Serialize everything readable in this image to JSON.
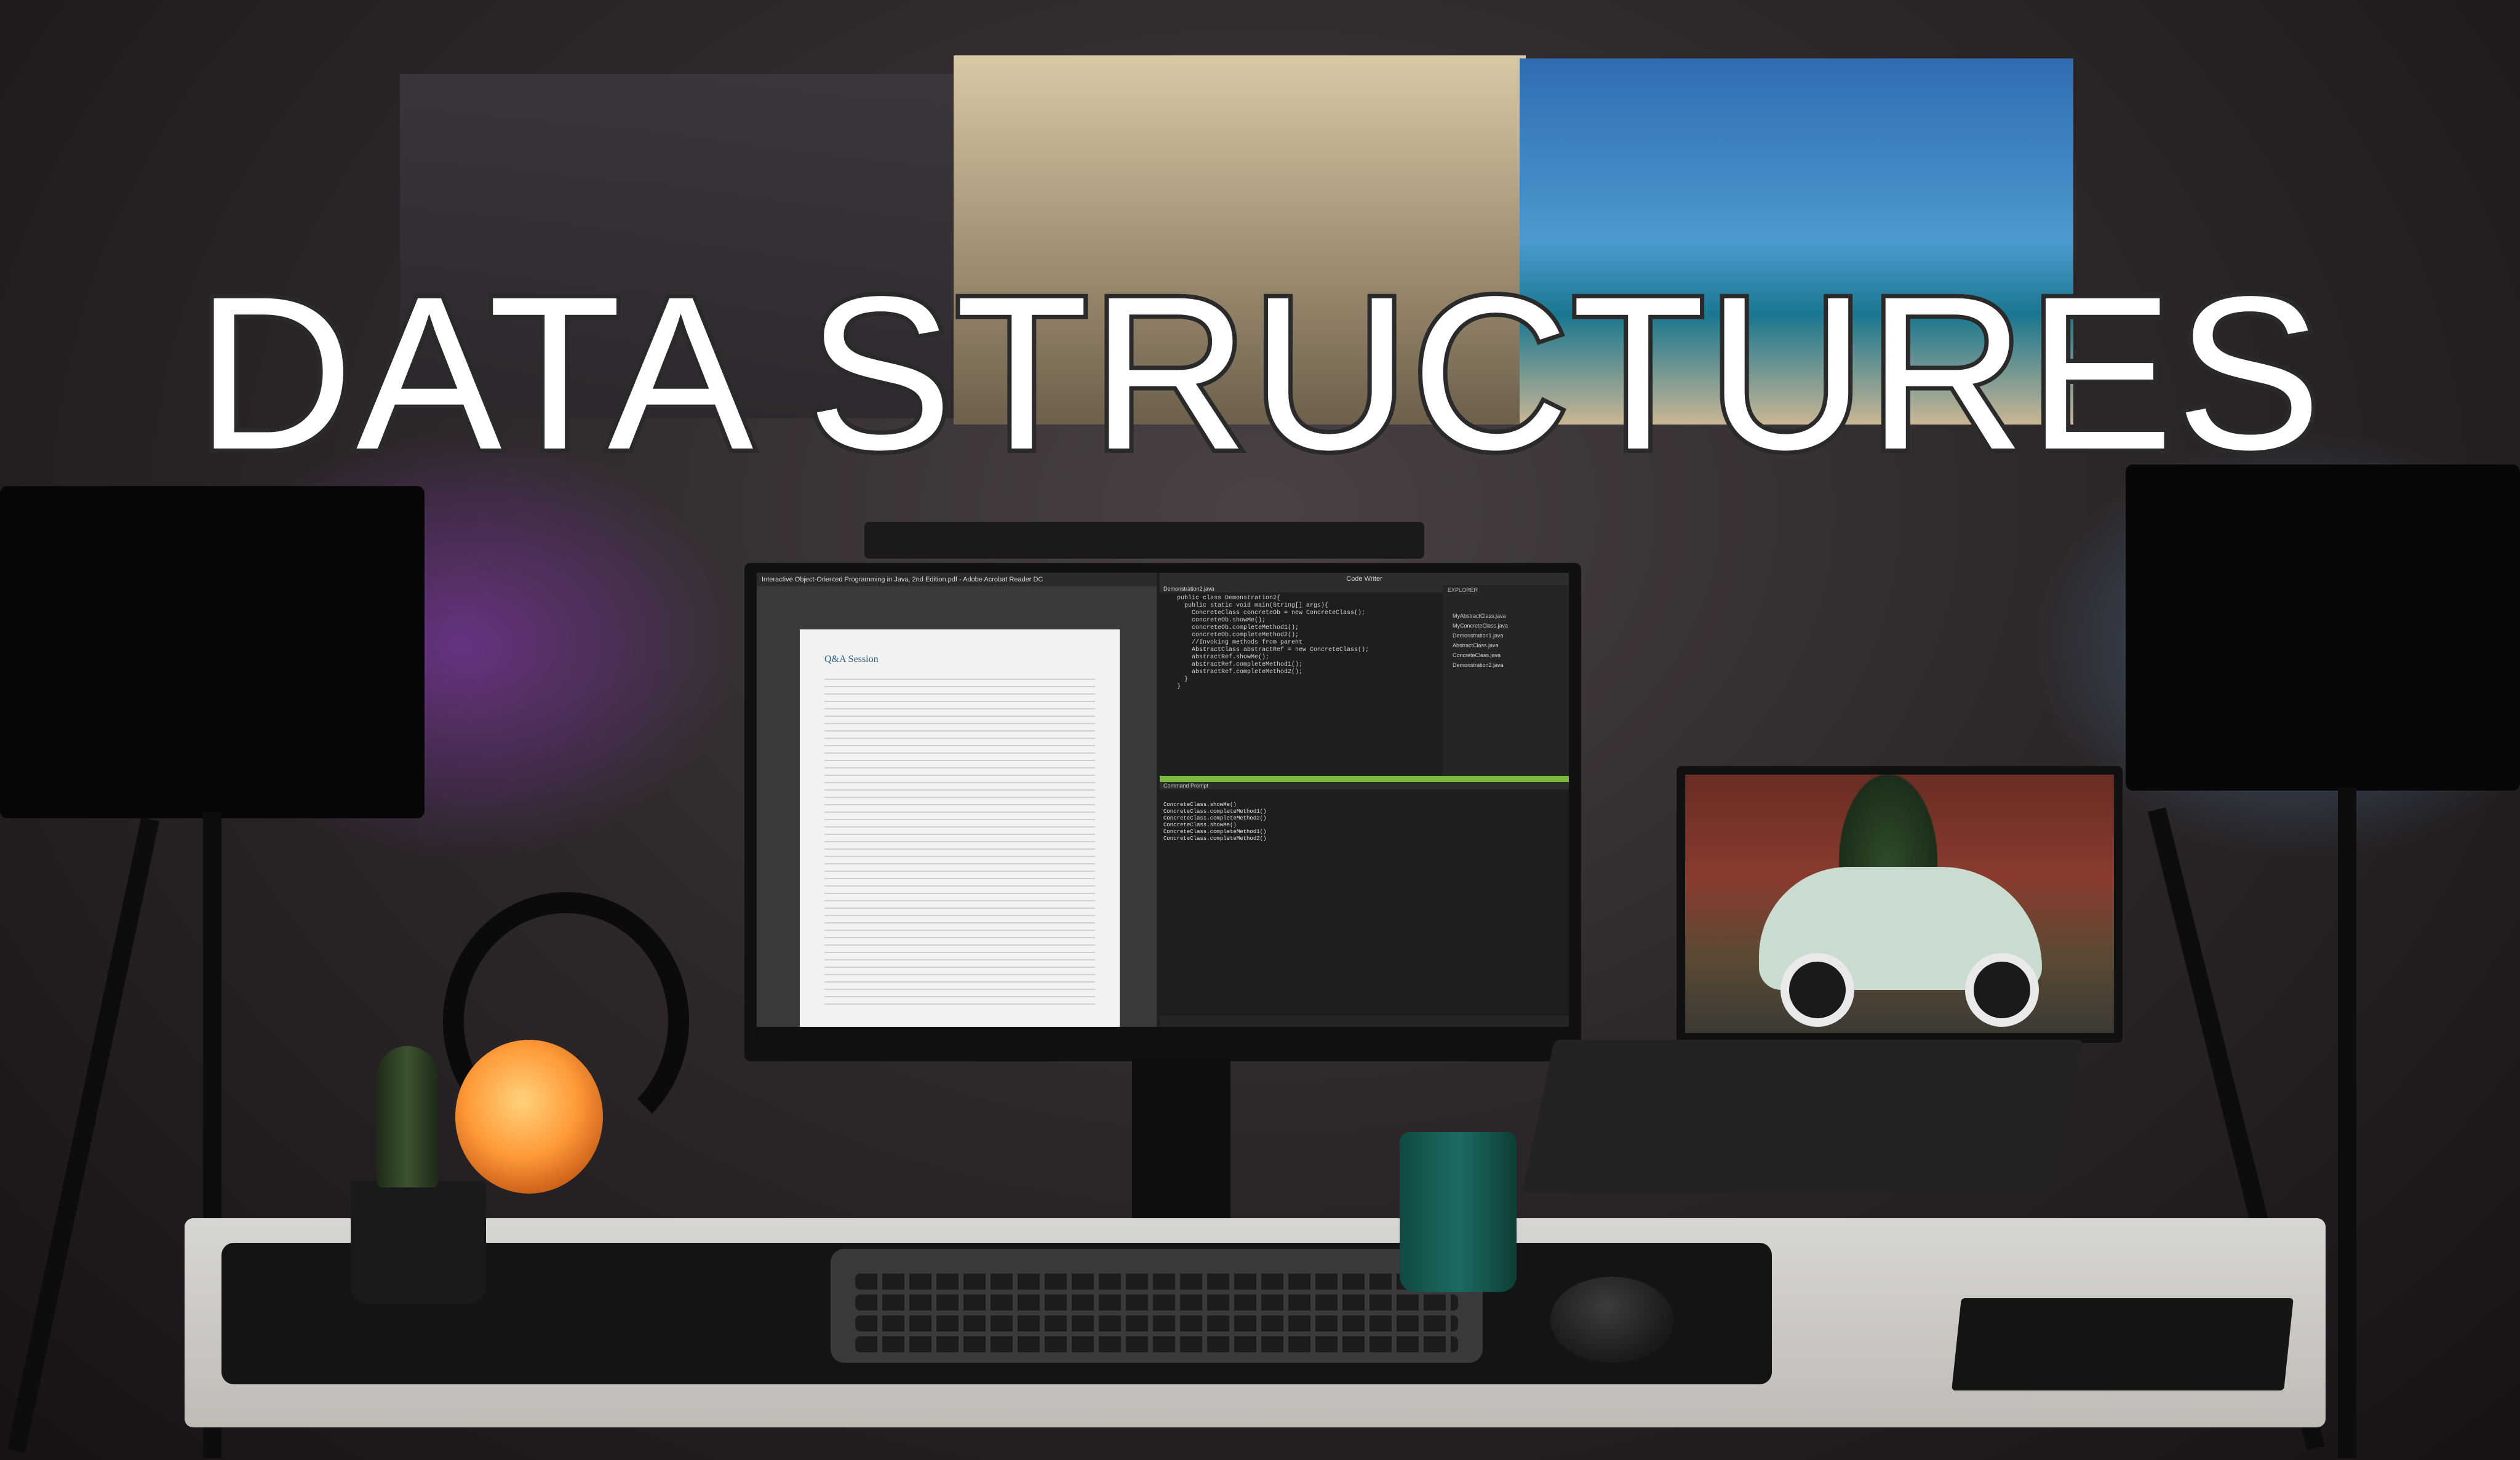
{
  "overlay": {
    "title": "DATA STRUCTURES"
  },
  "monitor": {
    "pdf_window_title": "Interactive Object-Oriented Programming in Java, 2nd Edition.pdf - Adobe Acrobat Reader DC",
    "pdf_section_title": "Q&A Session",
    "code_window_title": "Code Writer",
    "editor_tab": "Demonstration2.java",
    "code_lines": [
      "public class Demonstration2{",
      "  public static void main(String[] args){",
      "    ConcreteClass concreteOb = new ConcreteClass();",
      "    concreteOb.showMe();",
      "    concreteOb.completeMethod1();",
      "    concreteOb.completeMethod2();",
      "",
      "    //Invoking methods from parent",
      "    AbstractClass abstractRef = new ConcreteClass();",
      "    abstractRef.showMe();",
      "    abstractRef.completeMethod1();",
      "    abstractRef.completeMethod2();",
      "  }",
      "}"
    ],
    "explorer_title": "EXPLORER",
    "explorer_files": [
      "MyAbstractClass.java",
      "MyConcreteClass.java",
      "Demonstration1.java",
      "AbstractClass.java",
      "ConcreteClass.java",
      "Demonstration2.java"
    ],
    "terminal_title": "Command Prompt",
    "terminal_lines": [
      "ConcreteClass.showMe()",
      "ConcreteClass.completeMethod1()",
      "ConcreteClass.completeMethod2()",
      "ConcreteClass.showMe()",
      "ConcreteClass.completeMethod1()",
      "ConcreteClass.completeMethod2()"
    ]
  },
  "colors": {
    "title_fill": "#ffffff",
    "title_outline": "#2a2a2a",
    "lamp_glow_left": "#9a3cc8",
    "lamp_glow_right": "#5aaae6",
    "status_bar": "#7cba3a"
  }
}
